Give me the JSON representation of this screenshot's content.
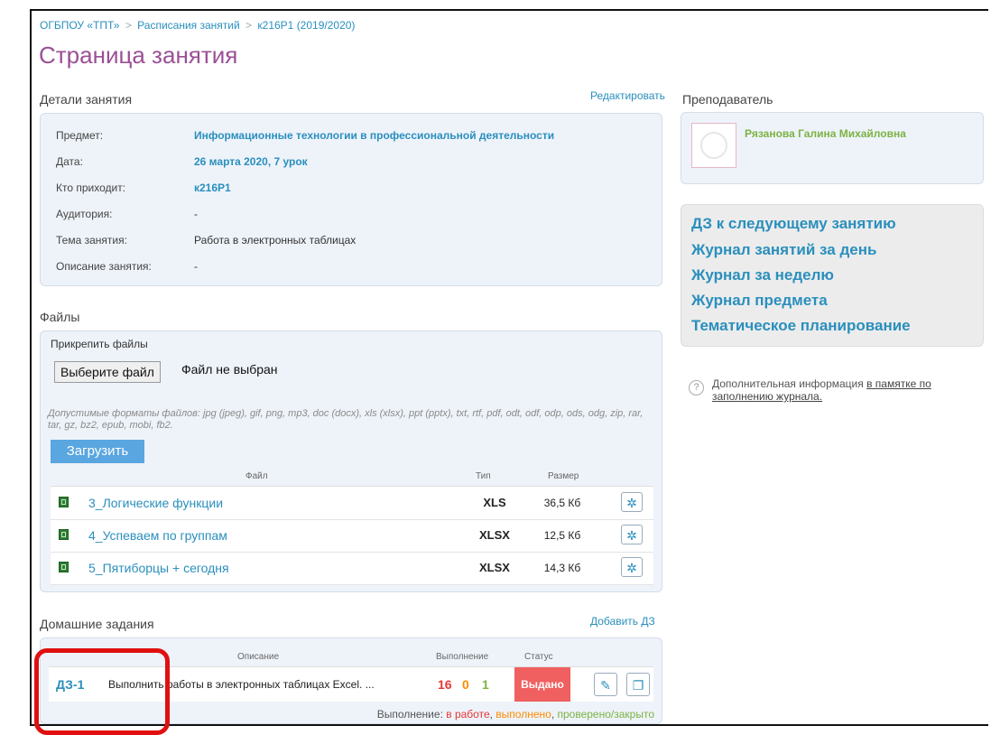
{
  "breadcrumb": {
    "root": "ОГБПОУ «ТПТ»",
    "schedule": "Расписания занятий",
    "group": "к216Р1 (2019/2020)",
    "separator": ">"
  },
  "page_title": "Страница занятия",
  "details": {
    "heading": "Детали занятия",
    "edit_link": "Редактировать",
    "rows": [
      {
        "label": "Предмет:",
        "value": "Информационные технологии в профессиональной деятельности",
        "is_link": true
      },
      {
        "label": "Дата:",
        "value": "26 марта 2020, 7 урок",
        "is_link": true
      },
      {
        "label": "Кто приходит:",
        "value": "к216Р1",
        "is_link": true
      },
      {
        "label": "Аудитория:",
        "value": "-",
        "is_link": false
      },
      {
        "label": "Тема занятия:",
        "value": "Работа в электронных таблицах",
        "is_link": false
      },
      {
        "label": "Описание занятия:",
        "value": "-",
        "is_link": false
      }
    ]
  },
  "files": {
    "heading": "Файлы",
    "attach_label": "Прикрепить файлы",
    "choose_button": "Выберите файл",
    "no_file": "Файл не выбран",
    "formats_text": "Допустимые форматы файлов: jpg (jpeg), gif, png, mp3, doc (docx), xls (xlsx), ppt (pptx), txt, rtf, pdf, odt, odf, odp, ods, odg, zip, rar, tar, gz, bz2, epub, mobi, fb2.",
    "upload_button": "Загрузить",
    "columns": {
      "file": "Файл",
      "type": "Тип",
      "size": "Размер"
    },
    "items": [
      {
        "name": "3_Логические функции",
        "type": "XLS",
        "size": "36,5 Кб",
        "icon": "excel-file-icon"
      },
      {
        "name": "4_Успеваем по группам",
        "type": "XLSX",
        "size": "12,5 Кб",
        "icon": "excel-file-icon"
      },
      {
        "name": "5_Пятиборцы + сегодня",
        "type": "XLSX",
        "size": "14,3 Кб",
        "icon": "excel-file-icon"
      }
    ],
    "delete_icon": "delete-icon"
  },
  "homework": {
    "heading": "Домашние задания",
    "add_link": "Добавить ДЗ",
    "columns": {
      "description": "Описание",
      "completion": "Выполнение",
      "status": "Статус"
    },
    "items": [
      {
        "id": "ДЗ-1",
        "description": "Выполнить работы в электронных таблицах Excel. ...",
        "in_progress": "16",
        "done": "0",
        "checked": "1",
        "status": "Выдано",
        "status_color": "#f06060"
      }
    ],
    "legend": {
      "prefix": "Выполнение:",
      "in_progress": "в работе",
      "done": "выполнено",
      "checked": "проверено/закрыто"
    }
  },
  "teacher": {
    "heading": "Преподаватель",
    "name": "Рязанова Галина Михайловна",
    "avatar_icon": "avatar-placeholder-icon"
  },
  "quick_links": [
    "ДЗ к следующему занятию",
    "Журнал занятий за день",
    "Журнал за неделю",
    "Журнал предмета",
    "Тематическое планирование"
  ],
  "help": {
    "icon": "question-icon",
    "text": "Дополнительная информация",
    "link": "в памятке по заполнению журнала."
  },
  "colors": {
    "accent": "#2a8fbd",
    "title": "#9b4f96",
    "status": "#f06060",
    "panel": "#eef3fa",
    "annotation": "#e01010"
  }
}
